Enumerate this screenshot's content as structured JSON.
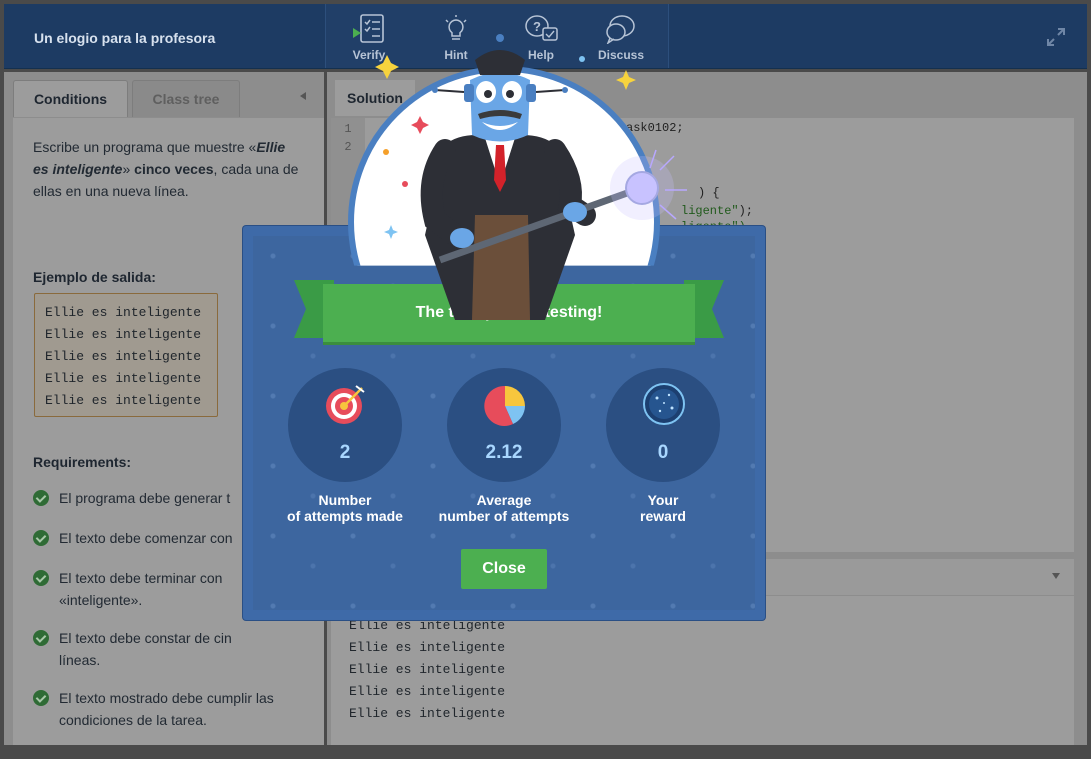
{
  "header": {
    "task_title": "Un elogio para la profesora",
    "tools": [
      {
        "label": "Verify",
        "icon": "verify-icon"
      },
      {
        "label": "Hint",
        "icon": "lightbulb-icon"
      },
      {
        "label": "Help",
        "icon": "help-icon"
      },
      {
        "label": "Discuss",
        "icon": "discuss-icon"
      }
    ]
  },
  "left_tabs": {
    "conditions": "Conditions",
    "class_tree": "Class tree"
  },
  "conditions": {
    "intro_pre": "Escribe un programa que muestre «",
    "intro_em": "Ellie es inteligente",
    "intro_mid": "» ",
    "intro_bold": "cinco veces",
    "intro_post": ", cada una de ellas en una nueva línea.",
    "example_heading": "Ejemplo de salida:",
    "example_lines": [
      "Ellie es inteligente",
      "Ellie es inteligente",
      "Ellie es inteligente",
      "Ellie es inteligente",
      "Ellie es inteligente"
    ],
    "requirements_heading": "Requirements:",
    "requirements": [
      "El programa debe generar t",
      "El texto debe comenzar con",
      "El texto debe terminar con «inteligente».",
      "El texto debe constar de cin líneas.",
      "El texto mostrado debe cumplir las condiciones de la tarea."
    ]
  },
  "solution": {
    "tab_label": "Solution",
    "line_numbers": [
      "1",
      "2"
    ],
    "code_fragments": {
      "line1": "ask0102;",
      "brace": ") {",
      "str1": "ligente\"",
      "str1_end": ");",
      "str2": "ligente\")"
    }
  },
  "output": {
    "lines": [
      "Ellie es inteligente",
      "Ellie es inteligente",
      "Ellie es inteligente",
      "Ellie es inteligente",
      "Ellie es inteligente"
    ]
  },
  "modal": {
    "title": "The task passed testing!",
    "stats": [
      {
        "value": "2",
        "label_line1": "Number",
        "label_line2": "of attempts made",
        "icon": "target-icon"
      },
      {
        "value": "2.12",
        "label_line1": "Average",
        "label_line2": "number of attempts",
        "icon": "pie-chart-icon"
      },
      {
        "value": "0",
        "label_line1": "Your",
        "label_line2": "reward",
        "icon": "galaxy-icon"
      }
    ],
    "close_label": "Close"
  },
  "colors": {
    "accent_green": "#4caf50",
    "modal_blue": "#3d669f",
    "header_navy": "#1d3b63"
  }
}
